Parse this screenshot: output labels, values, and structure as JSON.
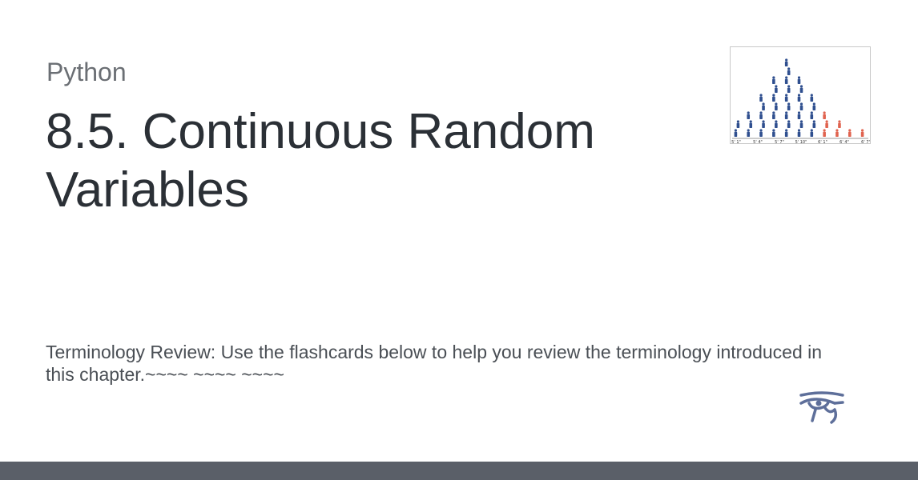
{
  "header": {
    "category": "Python",
    "title": "8.5. Continuous Random Variables"
  },
  "description": "Terminology Review: Use the flashcards below to help you review the terminology introduced in this chapter.~~~~ ~~~~ ~~~~",
  "thumbnail": {
    "axis_labels": [
      "5' 1\"",
      "5' 4\"",
      "5' 7\"",
      "5' 10\"",
      "6' 1\"",
      "6' 4\"",
      "6' 7\""
    ],
    "colors": {
      "primary": "#2f4f8f",
      "highlight": "#e0634f"
    }
  },
  "logo": {
    "icon": "eye-of-horus-icon",
    "color": "#5e6f9a"
  },
  "colors": {
    "footer": "#5a5f68",
    "text": "#2b3036"
  }
}
